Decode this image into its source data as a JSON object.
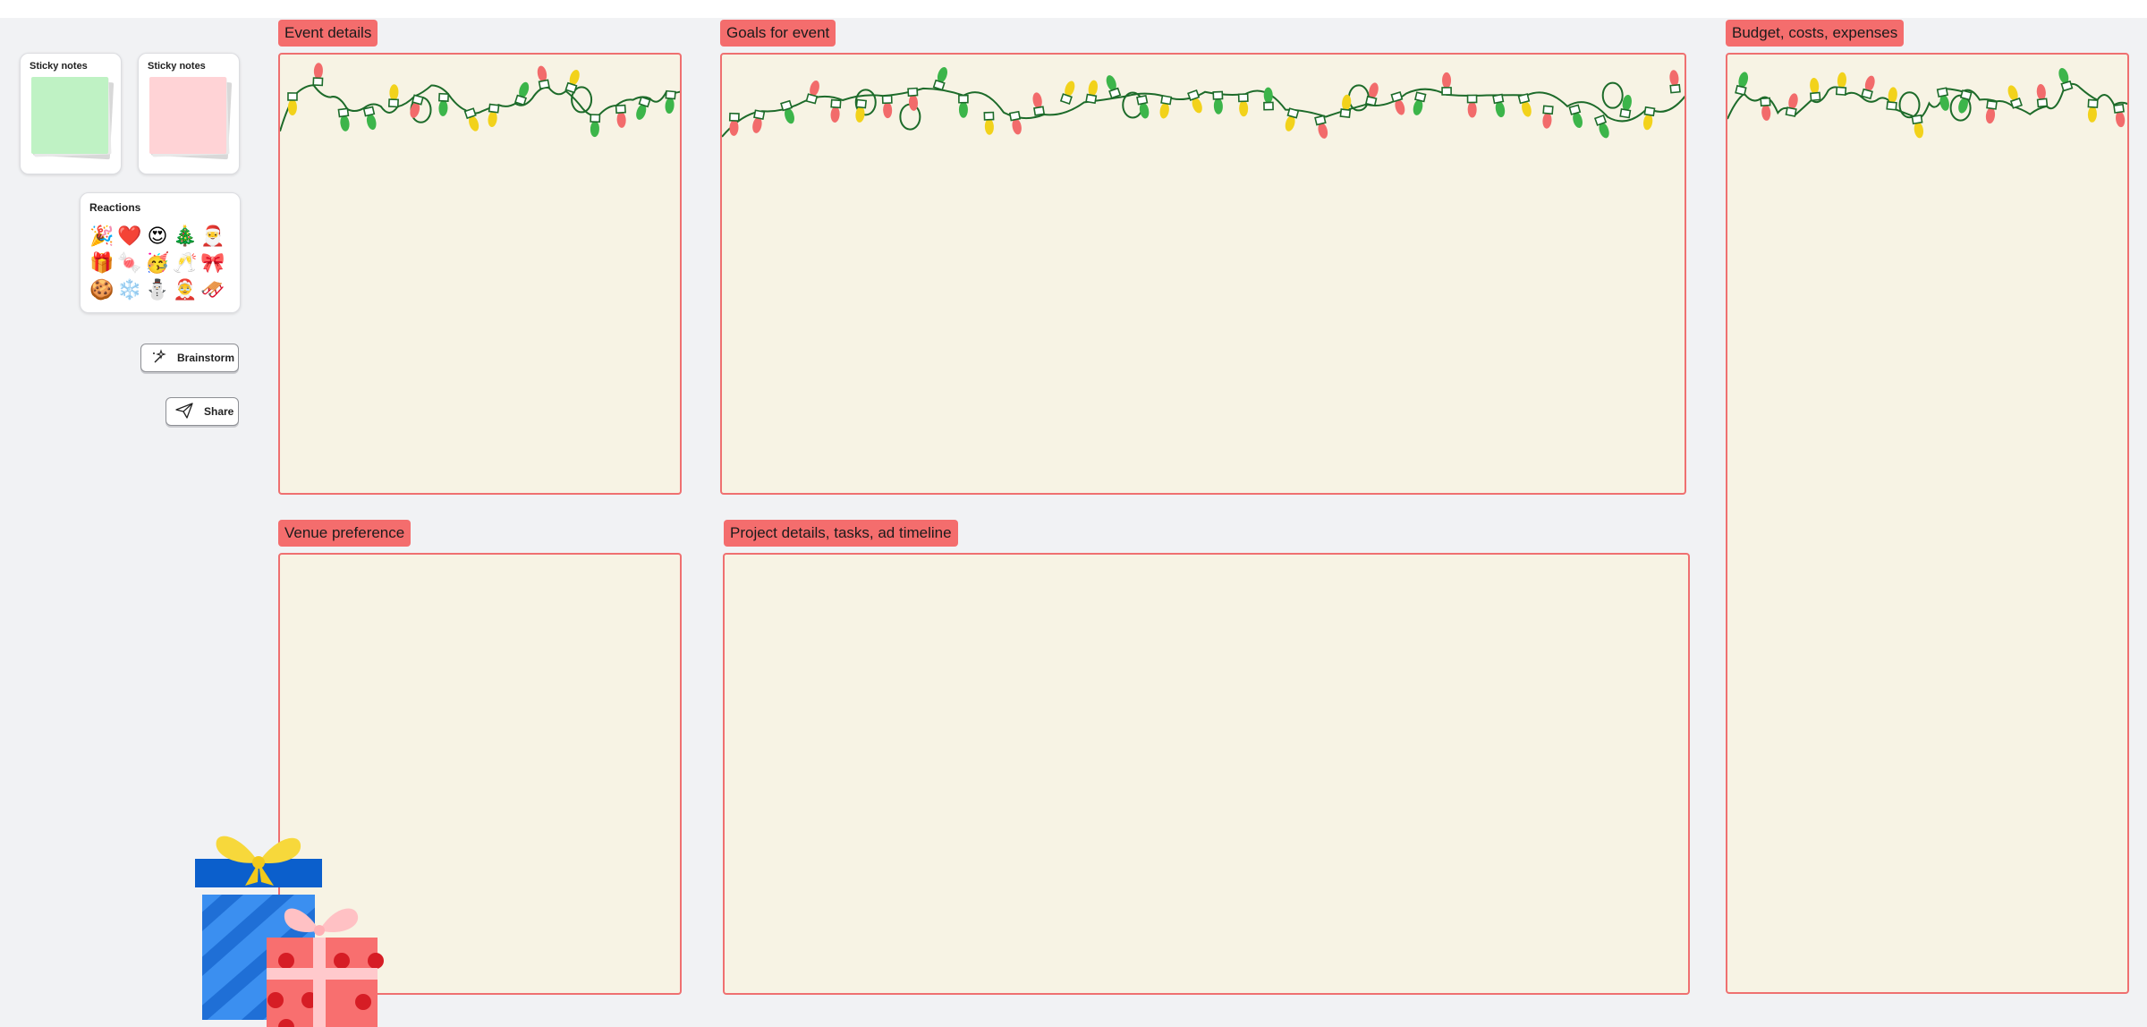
{
  "palette": {
    "sticky_green": {
      "title": "Sticky notes",
      "color": "#bff2c4"
    },
    "sticky_pink": {
      "title": "Sticky notes",
      "color": "#ffd3d6"
    },
    "reactions": {
      "title": "Reactions",
      "items": [
        "🎉",
        "❤️",
        "😍",
        "🎄",
        "🎅",
        "🎁",
        "🍬",
        "🥳",
        "🥂",
        "🎀",
        "🍪",
        "❄️",
        "⛄",
        "🤶",
        "🛷"
      ]
    },
    "brainstorm_label": "Brainstorm",
    "share_label": "Share"
  },
  "frames": {
    "event_details": "Event details",
    "goals": "Goals for event",
    "budget": "Budget, costs, expenses",
    "venue": "Venue preference",
    "project": "Project details, tasks, ad timeline"
  },
  "colors": {
    "frame_border": "#ef7070",
    "frame_label_bg": "#f46d6d",
    "frame_bg": "#f7f3e4",
    "canvas_bg": "#f1f2f4",
    "light_red": "#f26b6b",
    "light_green": "#3cb54a",
    "light_yellow": "#f2d21b",
    "wire": "#1d6b2a"
  }
}
